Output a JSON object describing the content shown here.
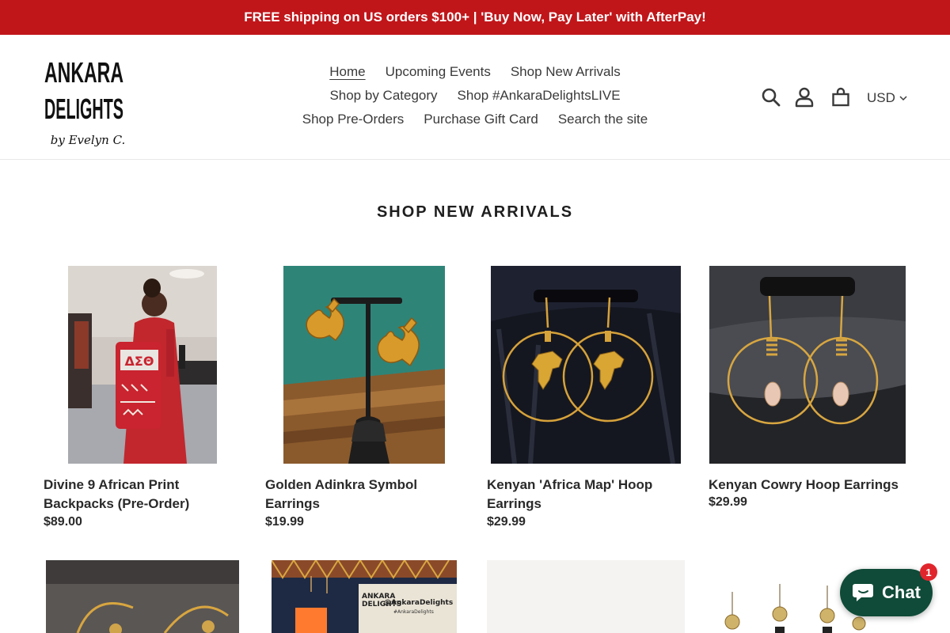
{
  "announcement": {
    "text": "FREE shipping on US orders $100+ | 'Buy Now, Pay Later' with AfterPay!"
  },
  "logo": {
    "line1": "ANKARA",
    "line2": "DELIGHTS",
    "tagline": "by Evelyn C."
  },
  "nav": {
    "row1": [
      {
        "label": "Home",
        "active": true
      },
      {
        "label": "Upcoming Events"
      },
      {
        "label": "Shop New Arrivals"
      }
    ],
    "row2": [
      {
        "label": "Shop by Category"
      },
      {
        "label": "Shop #AnkaraDelightsLIVE"
      }
    ],
    "row3": [
      {
        "label": "Shop Pre-Orders"
      },
      {
        "label": "Purchase Gift Card"
      },
      {
        "label": "Search the site"
      }
    ]
  },
  "header_icons": [
    "search-icon",
    "account-icon",
    "cart-icon"
  ],
  "currency": {
    "value": "USD"
  },
  "section": {
    "title": "SHOP NEW ARRIVALS"
  },
  "products": [
    {
      "name_line1": "Divine 9 African Print",
      "name_line2": "Backpacks (Pre-Order)",
      "price": "$89.00"
    },
    {
      "name_line1": "Golden Adinkra Symbol",
      "name_line2": "Earrings",
      "price": "$19.99"
    },
    {
      "name_line1": "Kenyan 'Africa Map' Hoop",
      "name_line2": "Earrings",
      "price": "$29.99"
    },
    {
      "name_line1": "Kenyan Cowry Hoop Earrings",
      "name_line2": "",
      "price": "$29.99"
    }
  ],
  "photo_text": {
    "backpack_letters": "ΔΣΘ",
    "sign_line1": "ANKARA",
    "sign_line2": "DELIGHTS",
    "sign_handle": "@AnkaraDelights",
    "sign_tag": "#AnkaraDelights"
  },
  "chat": {
    "label": "Chat",
    "badge": "1"
  },
  "colors": {
    "brand_red": "#c0161a",
    "chat_green": "#0f4b38",
    "badge_red": "#e1252d"
  }
}
